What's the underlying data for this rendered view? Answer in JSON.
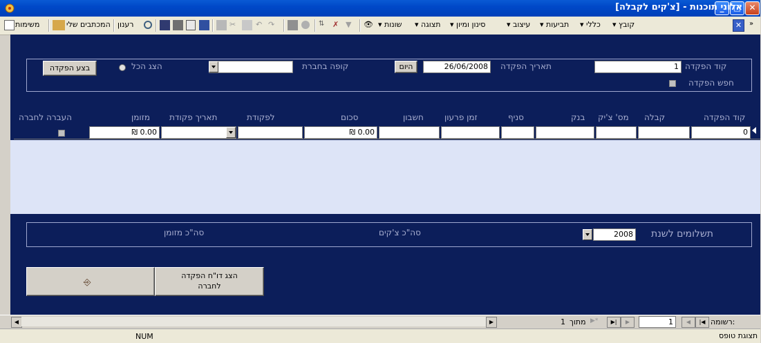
{
  "window": {
    "title": "[אלוני תוכנות - [צ'קים לקבלה"
  },
  "toolbar": {
    "menus": [
      "קובץ",
      "כללי",
      "תביעות",
      "עיצוב",
      "סינון ומיון",
      "תצוגה",
      "שונות"
    ],
    "reports_label": "רענון",
    "letters_label": "המכתבים שלי",
    "tasks_label": "משימות"
  },
  "header": {
    "deposit_code_label": "קוד הפקדה",
    "deposit_code_value": "1",
    "search_deposit_label": "חפש הפקדה",
    "deposit_date_label": "תאריך הפקדה",
    "deposit_date_value": "26/06/2008",
    "today_button": "היום",
    "cashbox_label": "קופה בחברת",
    "cashbox_value": "",
    "show_all_label": "הצג הכל",
    "perform_deposit_button": "בצע הפקדה"
  },
  "grid": {
    "columns": [
      "קוד הפקדה",
      "קבלה",
      "מס' צ'יק",
      "בנק",
      "סניף",
      "זמן פרעון",
      "חשבון",
      "סכום",
      "לפקודת",
      "תאריך פקודת",
      "מזומן",
      "העברה לחברה"
    ],
    "row": {
      "deposit_code": "0",
      "amount": "₪ 0.00",
      "cash": "₪ 0.00"
    }
  },
  "footer": {
    "payments_year_label": "תשלומים לשנת",
    "payments_year_value": "2008",
    "total_checks_label": "סה\"כ צ'קים",
    "total_cash_label": "סה\"כ מזומן",
    "report_button": "הצג דו\"ח הפקדה לחברה"
  },
  "navigation": {
    "record_label": "רשומה:",
    "current_record": "1",
    "of_label": "מתוך",
    "total_records": "1"
  },
  "status": {
    "form_view": "תצוגת טופס",
    "num": "NUM"
  },
  "colors": {
    "form_bg": "#0c1e5a",
    "title_bar": "#0048c8",
    "detail_bg": "#dde4f7"
  }
}
